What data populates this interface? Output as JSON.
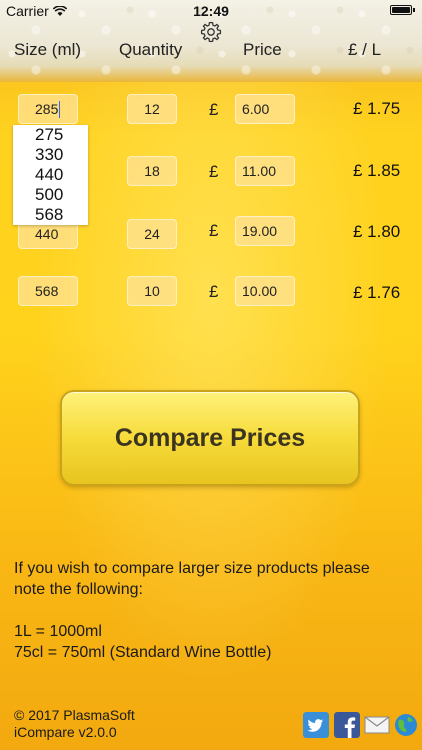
{
  "status": {
    "carrier": "Carrier",
    "time": "12:49"
  },
  "headers": {
    "size": "Size (ml)",
    "quantity": "Quantity",
    "price": "Price",
    "per_litre": "£ / L"
  },
  "currency_symbol": "£",
  "rows": [
    {
      "size": "285",
      "quantity": "12",
      "price": "6.00",
      "per_litre": "£ 1.75"
    },
    {
      "size": "330",
      "quantity": "18",
      "price": "11.00",
      "per_litre": "£ 1.85"
    },
    {
      "size": "440",
      "quantity": "24",
      "price": "19.00",
      "per_litre": "£ 1.80"
    },
    {
      "size": "568",
      "quantity": "10",
      "price": "10.00",
      "per_litre": "£ 1.76"
    }
  ],
  "size_options": [
    "275",
    "330",
    "440",
    "500",
    "568"
  ],
  "compare_button": "Compare Prices",
  "info": {
    "line1": "If you wish to compare larger size products please",
    "line2": "note the following:",
    "line3": "1L = 1000ml",
    "line4": "75cl = 750ml (Standard Wine Bottle)"
  },
  "footer": {
    "copyright": "© 2017 PlasmaSoft",
    "version": "iCompare v2.0.0"
  },
  "icons": {
    "settings": "gear-icon",
    "twitter": "twitter-icon",
    "facebook": "facebook-icon",
    "email": "email-icon",
    "web": "globe-icon"
  },
  "colors": {
    "twitter": "#3a8fd9",
    "facebook": "#3b5998",
    "button": "#f6db3a"
  }
}
